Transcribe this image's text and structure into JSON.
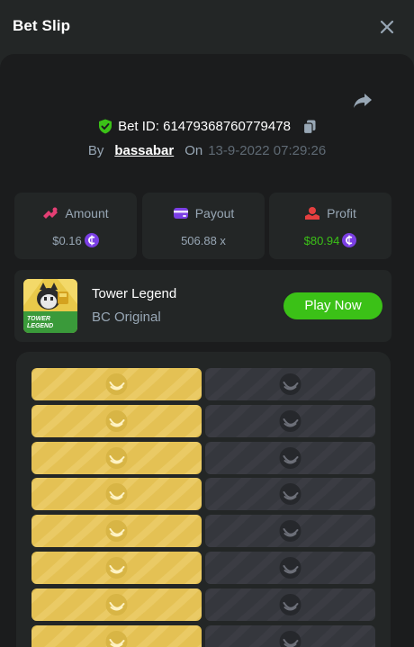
{
  "header": {
    "title": "Bet Slip"
  },
  "bet": {
    "id_text": "Bet ID: 61479368760779478",
    "by_label": "By",
    "username": "bassabar",
    "on_label": "On",
    "date": "13-9-2022 07:29:26"
  },
  "stats": {
    "amount": {
      "label": "Amount",
      "value": "$0.16"
    },
    "payout": {
      "label": "Payout",
      "value": "506.88 x"
    },
    "profit": {
      "label": "Profit",
      "value": "$80.94"
    }
  },
  "game": {
    "name": "Tower Legend",
    "provider": "BC Original",
    "thumb_text_line1": "TOWER",
    "thumb_text_line2": "LEGEND",
    "play_label": "Play Now"
  },
  "board": {
    "rows": [
      [
        "gold",
        "dark"
      ],
      [
        "gold",
        "dark"
      ],
      [
        "gold",
        "dark"
      ],
      [
        "gold",
        "dark"
      ],
      [
        "gold",
        "dark"
      ],
      [
        "gold",
        "dark"
      ],
      [
        "gold",
        "dark"
      ],
      [
        "gold",
        "dark"
      ]
    ]
  },
  "colors": {
    "accent_green": "#3bc117",
    "muted_text": "#98a7b5",
    "gold_tile": "#e4c154",
    "dark_tile": "#35373d",
    "coin_purple": "#7b3fe4",
    "amount_icon": "#e43f74",
    "payout_icon": "#7b3fe4",
    "profit_icon": "#e43f3f"
  },
  "icons": {
    "close": "close-icon",
    "share": "share-icon",
    "verified": "shield-check-icon",
    "copy": "copy-icon",
    "coin": "bc-coin-icon",
    "tile_gold": "banana-icon",
    "tile_dark": "skull-icon"
  }
}
